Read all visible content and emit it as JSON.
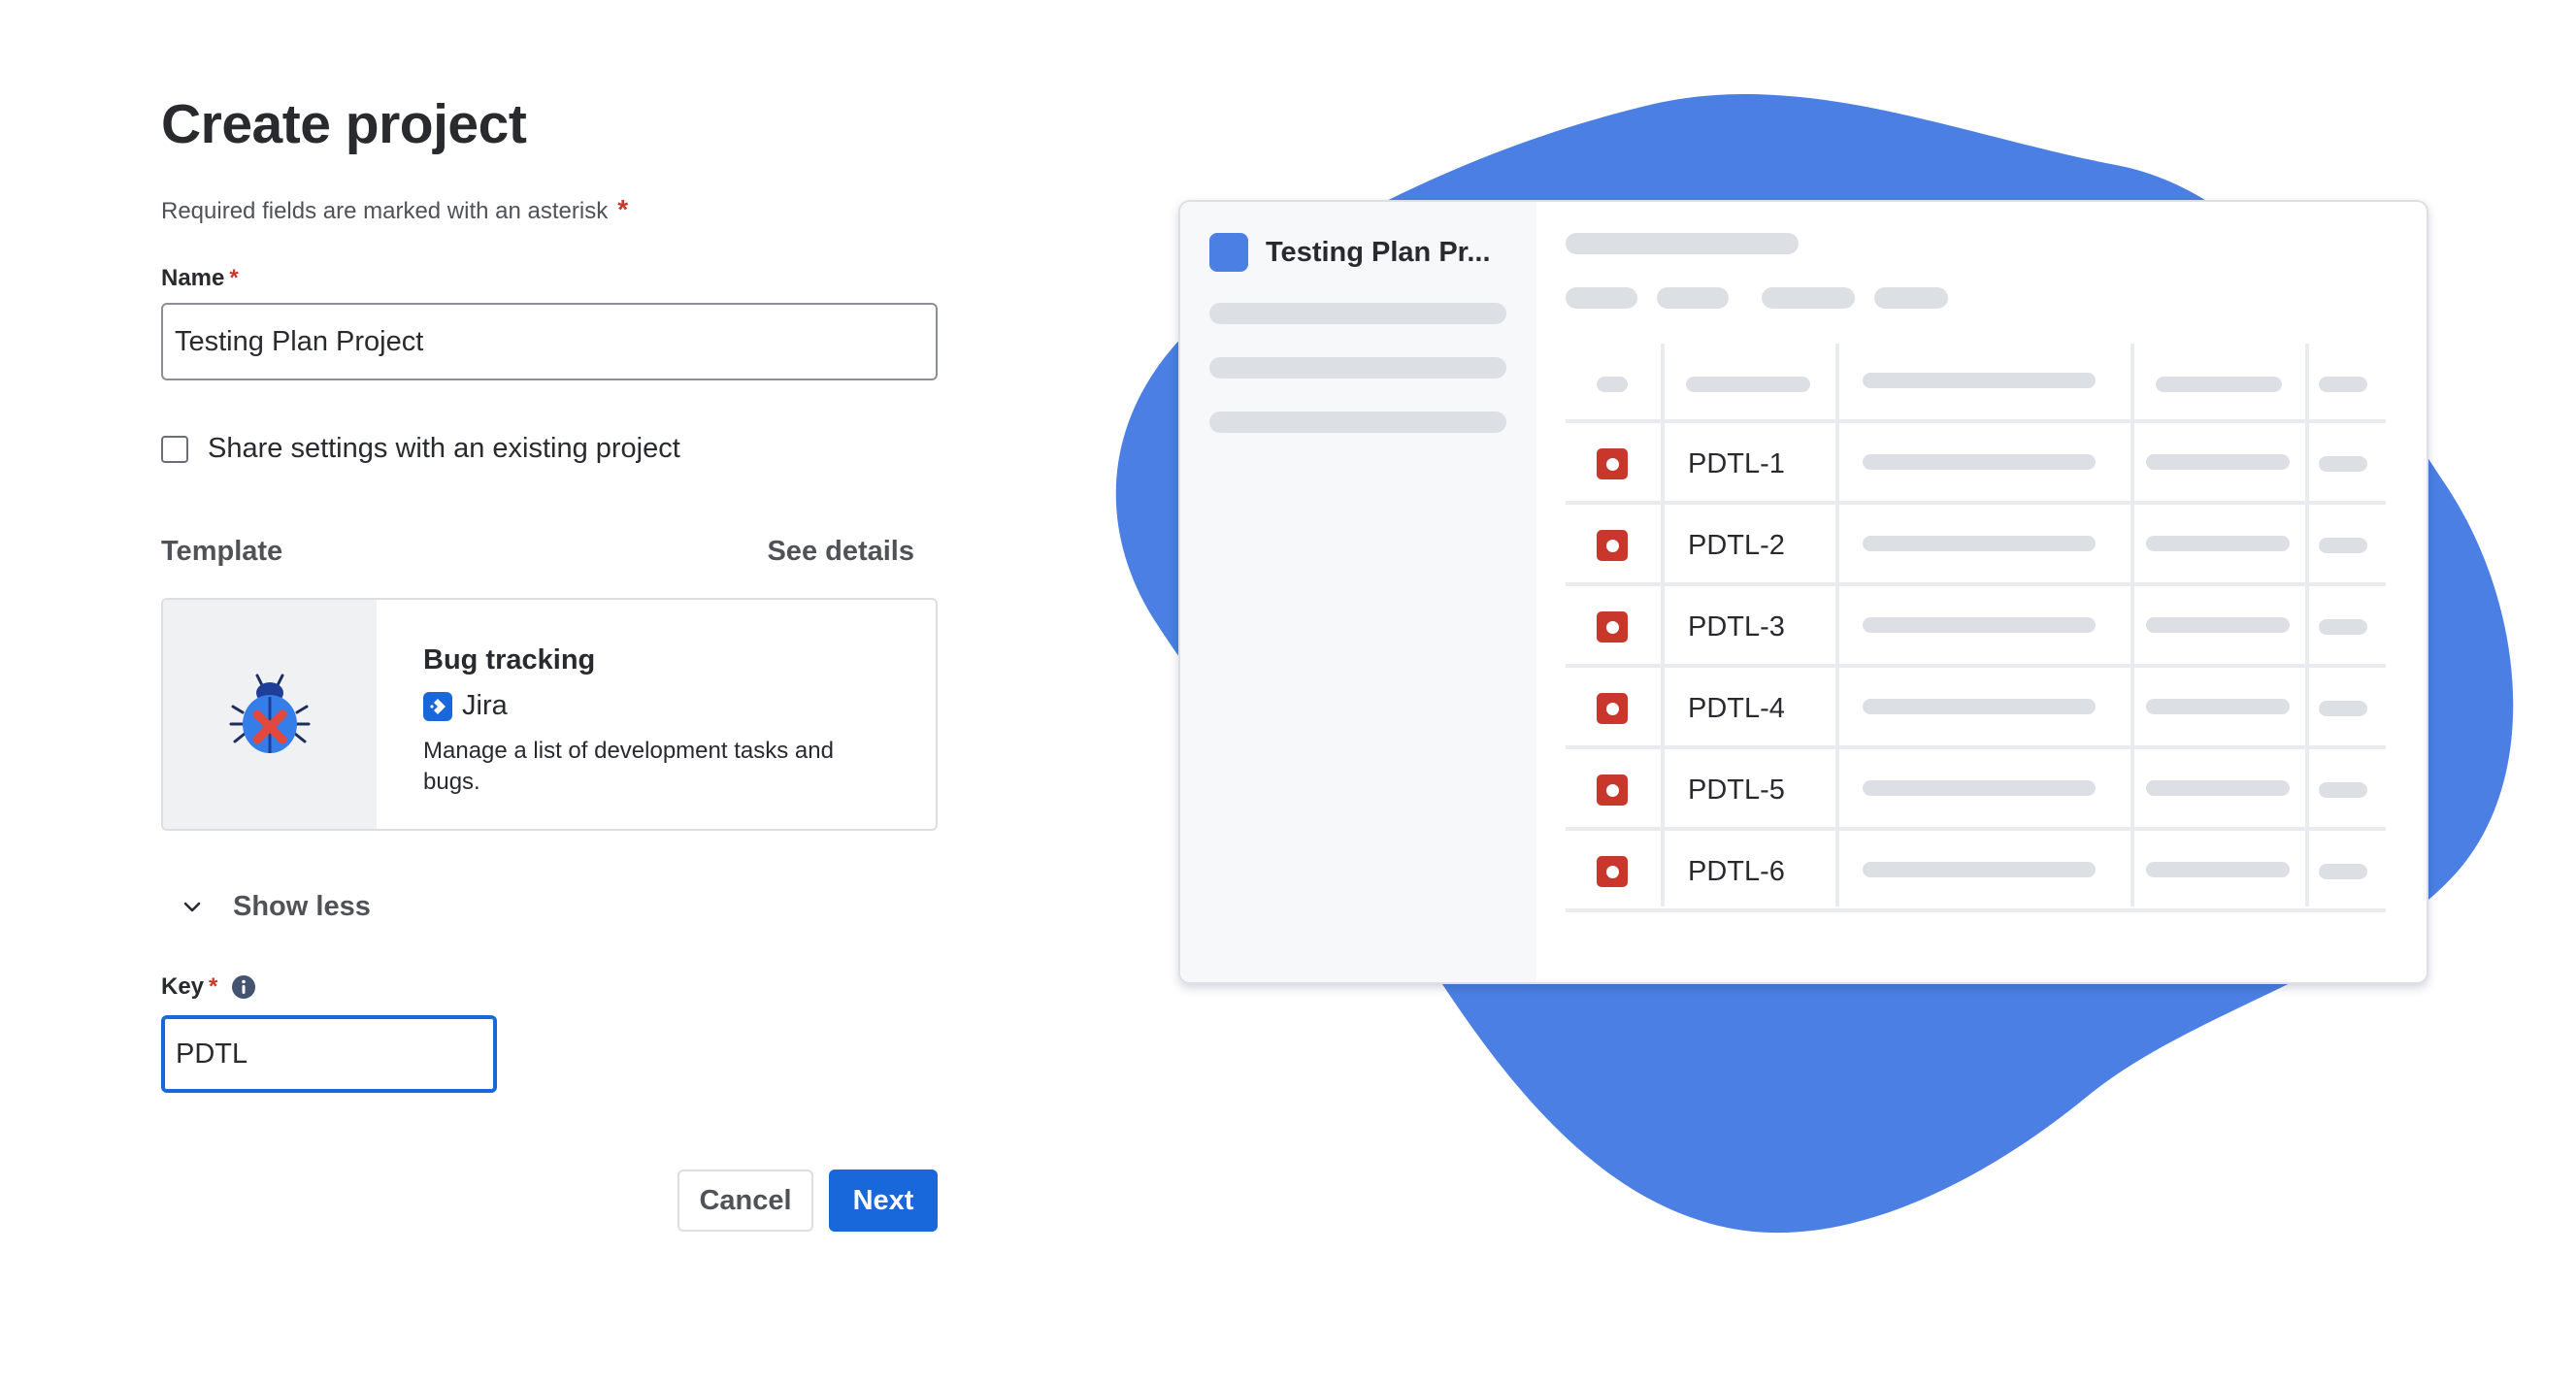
{
  "form": {
    "title": "Create project",
    "required_note": "Required fields are marked with an asterisk",
    "required_marker": "*",
    "name_label": "Name",
    "name_value": "Testing Plan Project",
    "share_settings_label": "Share settings with an existing project",
    "share_settings_checked": false,
    "template_heading": "Template",
    "see_details_label": "See details",
    "template": {
      "name": "Bug tracking",
      "product": "Jira",
      "description": "Manage a list of development tasks and bugs.",
      "icon": "bug-icon"
    },
    "show_less_label": "Show less",
    "key_label": "Key",
    "key_value": "PDTL",
    "cancel_label": "Cancel",
    "next_label": "Next"
  },
  "preview": {
    "project_name": "Testing Plan Pr...",
    "issues": [
      "PDTL-1",
      "PDTL-2",
      "PDTL-3",
      "PDTL-4",
      "PDTL-5",
      "PDTL-6"
    ]
  },
  "colors": {
    "primary": "#1868db",
    "blob": "#4b7fe3",
    "required": "#c9372c",
    "issue_bug": "#c9372c",
    "skeleton": "#dcdfe4"
  }
}
